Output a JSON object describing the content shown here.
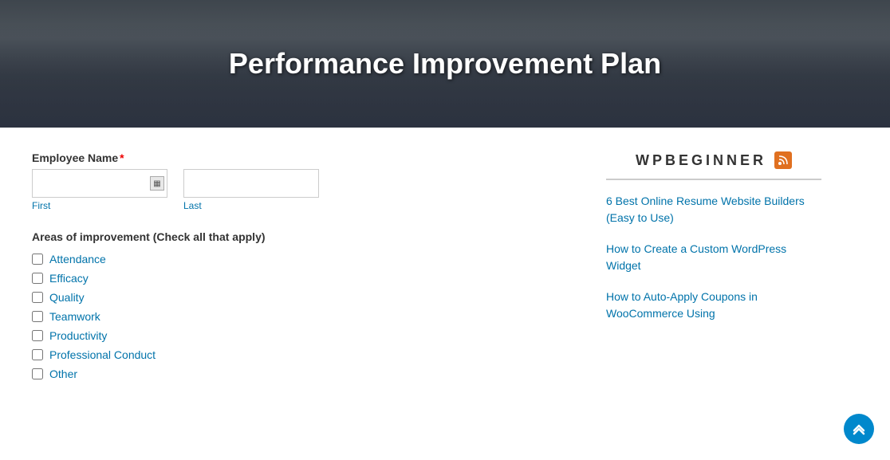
{
  "hero": {
    "title": "Performance Improvement Plan"
  },
  "form": {
    "employee_name_label": "Employee Name",
    "required_marker": "*",
    "first_placeholder": "",
    "last_placeholder": "",
    "first_sub_label": "First",
    "last_sub_label": "Last",
    "areas_label": "Areas of improvement (Check all that apply)",
    "checkboxes": [
      {
        "id": "attendance",
        "label": "Attendance"
      },
      {
        "id": "efficacy",
        "label": "Efficacy"
      },
      {
        "id": "quality",
        "label": "Quality"
      },
      {
        "id": "teamwork",
        "label": "Teamwork"
      },
      {
        "id": "productivity",
        "label": "Productivity"
      },
      {
        "id": "professional_conduct",
        "label": "Professional Conduct"
      },
      {
        "id": "other",
        "label": "Other"
      }
    ]
  },
  "sidebar": {
    "brand": "WPBEGINNER",
    "rss_symbol": "⊕",
    "links": [
      {
        "id": "link1",
        "text": "6 Best Online Resume Website Builders (Easy to Use)"
      },
      {
        "id": "link2",
        "text": "How to Create a Custom WordPress Widget"
      },
      {
        "id": "link3",
        "text": "How to Auto-Apply Coupons in WooCommerce Using"
      }
    ]
  },
  "scroll_top_icon": "⌃"
}
